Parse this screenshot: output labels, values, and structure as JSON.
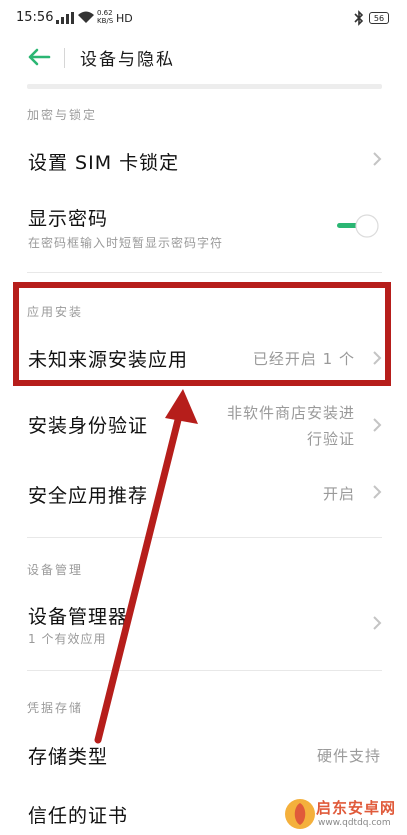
{
  "status": {
    "time": "15:56",
    "speed_top": "0.62",
    "speed_bottom": "KB/S",
    "net": "HD",
    "battery": "56"
  },
  "header": {
    "title": "设备与隐私"
  },
  "sections": {
    "encrypt": "加密与锁定",
    "install": "应用安装",
    "device": "设备管理",
    "credential": "凭据存储"
  },
  "rows": {
    "sim_lock": {
      "title": "设置 SIM 卡锁定"
    },
    "show_password": {
      "title": "显示密码",
      "sub": "在密码框输入时短暂显示密码字符",
      "toggle_on": true
    },
    "unknown_source": {
      "title": "未知来源安装应用",
      "value": "已经开启 1 个"
    },
    "install_verify": {
      "title": "安装身份验证",
      "value_line1": "非软件商店安装进",
      "value_line2": "行验证"
    },
    "security_recommend": {
      "title": "安全应用推荐",
      "value": "开启"
    },
    "device_admin": {
      "title": "设备管理器",
      "sub": "1 个有效应用"
    },
    "storage_type": {
      "title": "存储类型",
      "value": "硬件支持"
    },
    "trusted_certs": {
      "title": "信任的证书"
    }
  },
  "watermark": {
    "line1": "启东安卓网",
    "line2": "www.qdtdq.com"
  },
  "colors": {
    "accent": "#2bb673",
    "highlight": "#b61e1b"
  }
}
